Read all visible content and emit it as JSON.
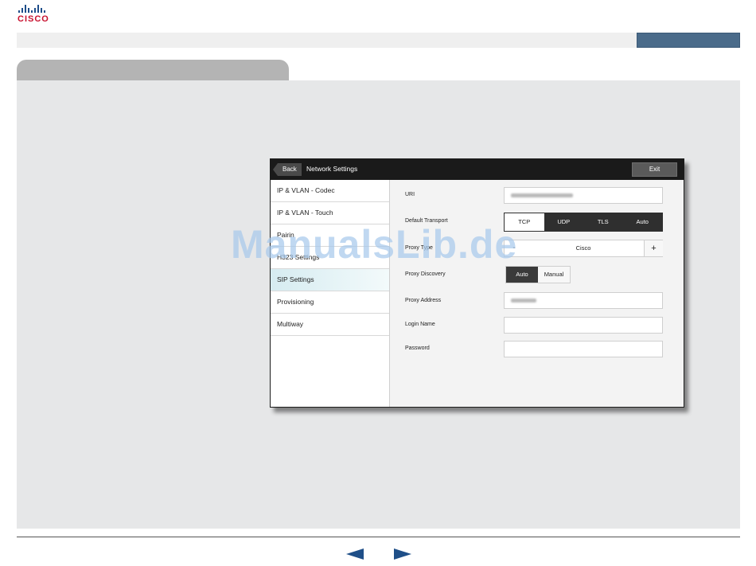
{
  "brand": {
    "logo_text": "CISCO",
    "logo_color": "#c8102e",
    "bars_color": "#1e4e8a"
  },
  "device": {
    "header": {
      "back_label": "Back",
      "title": "Network Settings",
      "exit_label": "Exit"
    },
    "sidebar": {
      "items": [
        {
          "label": "IP & VLAN - Codec"
        },
        {
          "label": "IP & VLAN - Touch"
        },
        {
          "label": "Pairin"
        },
        {
          "label": "H323 Settings"
        },
        {
          "label": "SIP Settings",
          "active": true
        },
        {
          "label": "Provisioning"
        },
        {
          "label": "Multiway"
        }
      ]
    },
    "form": {
      "uri": {
        "label": "URI"
      },
      "default_transport": {
        "label": "Default Transport",
        "options": [
          "TCP",
          "UDP",
          "TLS",
          "Auto"
        ],
        "selected": "TCP"
      },
      "proxy_type": {
        "label": "Proxy Type",
        "minus": "-",
        "value": "Cisco",
        "plus": "+"
      },
      "proxy_discovery": {
        "label": "Proxy Discovery",
        "options": [
          "Auto",
          "Manual"
        ],
        "selected": "Auto"
      },
      "proxy_address": {
        "label": "Proxy Address"
      },
      "login_name": {
        "label": "Login Name",
        "value": ""
      },
      "password": {
        "label": "Password",
        "value": ""
      }
    }
  },
  "watermark": "ManualsLib.de",
  "colors": {
    "accent": "#4a6b8a",
    "nav_arrow": "#1f4f88",
    "panel": "#e6e7e8",
    "active_item": "#d6ecf1"
  },
  "footer": {
    "prev_icon": "triangle-left-icon",
    "next_icon": "triangle-right-icon"
  }
}
